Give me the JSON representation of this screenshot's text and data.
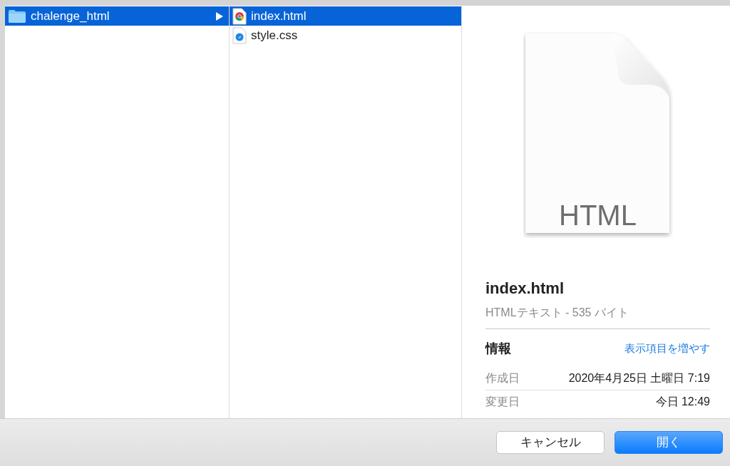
{
  "columns": [
    {
      "items": [
        {
          "kind": "folder",
          "label": "chalenge_html",
          "selected": true,
          "has_children": true
        }
      ]
    },
    {
      "items": [
        {
          "kind": "html",
          "label": "index.html",
          "selected": true,
          "has_children": false
        },
        {
          "kind": "css",
          "label": "style.css",
          "selected": false,
          "has_children": false
        }
      ]
    }
  ],
  "preview": {
    "icon_label": "HTML",
    "name": "index.html",
    "kind_size": "HTMLテキスト - 535 バイト",
    "info_title": "情報",
    "more_link": "表示項目を増やす",
    "rows": [
      {
        "label": "作成日",
        "value": "2020年4月25日 土曜日 7:19"
      },
      {
        "label": "変更日",
        "value": "今日 12:49"
      }
    ]
  },
  "buttons": [
    {
      "label": "キャンセル",
      "primary": false
    },
    {
      "label": "開く",
      "primary": true
    }
  ]
}
